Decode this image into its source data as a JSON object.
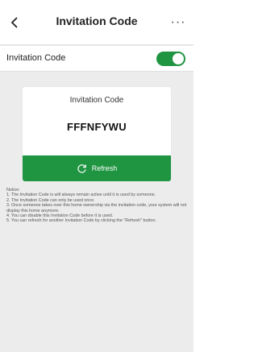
{
  "header": {
    "title": "Invitation Code",
    "back_icon": "chevron-left-icon",
    "more_icon": "more-horizontal-icon",
    "more_label": "···"
  },
  "toggle": {
    "label": "Invitation Code",
    "enabled": true,
    "color": "#1f9441"
  },
  "card": {
    "title": "Invitation Code",
    "code": "FFFNFYWU",
    "refresh_label": "Refresh",
    "refresh_icon": "refresh-icon",
    "button_color": "#1f9441"
  },
  "notice": {
    "heading": "Notice:",
    "items": [
      "1. The Invitation Code is will always remain active until it is used by someone.",
      "2. The Invitation Code can only be used once.",
      "3. Once someone takes over this home ownership via the invitation code, your system will not display this home anymore.",
      "4. You can disable this Invitation Code before it is used.",
      "5. You can refresh for another Invitation Code by clicking the \"Refresh\" button."
    ]
  }
}
